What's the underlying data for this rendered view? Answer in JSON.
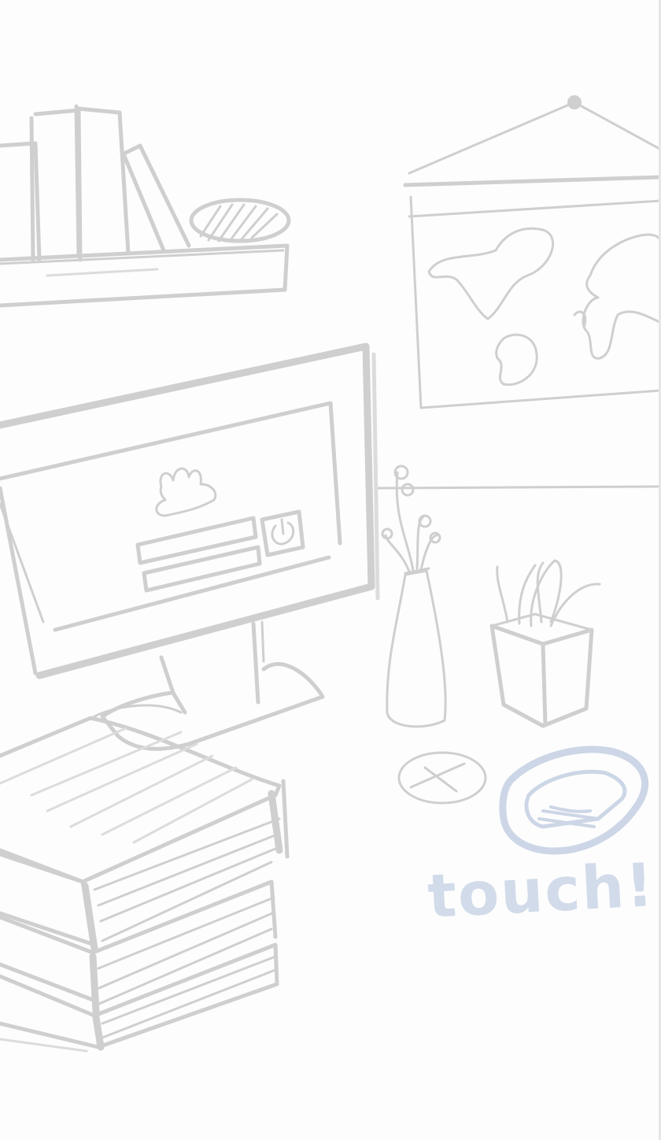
{
  "scene": {
    "hint_text": "touch!",
    "stroke_color": "#cfcfcf",
    "hint_color": "#ccd6e6",
    "background_color": "#fdfdfd"
  },
  "objects": {
    "bookshelf": "bookshelf",
    "world_map_poster": "world-map",
    "computer_monitor": "monitor",
    "login_screen": "login-screen",
    "power_button": "power-icon",
    "flower_vase": "vase",
    "pen_holder": "pencil-cup",
    "coaster": "coaster",
    "notebook": "notebook",
    "book_stack": "book-stack"
  }
}
